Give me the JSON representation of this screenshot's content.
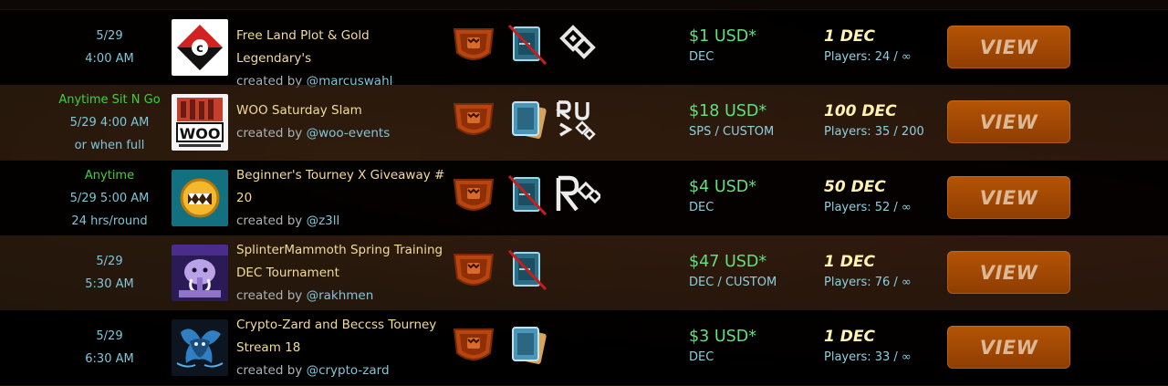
{
  "rows": [
    {
      "time": [
        "5/29",
        "4:00 AM"
      ],
      "time_highlight": "",
      "title": [
        "Free Land Plot & Gold Legendary's"
      ],
      "creator_prefix": "created by ",
      "creator": "@marcuswahl",
      "logo": "c-letter-logo",
      "format_icons": [
        "shield-icon",
        "card-crossed-icon",
        "diamond-rule-icon"
      ],
      "prize_amount": "$1 USD*",
      "prize_unit": "DEC",
      "entry_fee": "1 DEC",
      "players": "Players: 24 / ∞",
      "view_label": "VIEW"
    },
    {
      "time": [
        "5/29 4:00 AM",
        "or when full"
      ],
      "time_highlight": "Anytime Sit N Go",
      "title": [
        "WOO Saturday Slam"
      ],
      "creator_prefix": "created by ",
      "creator": "@woo-events",
      "logo": "woo-logo",
      "logo_text": "WOO",
      "format_icons": [
        "shield-icon",
        "cards-stack-icon",
        "ru-rules-icon"
      ],
      "prize_amount": "$18 USD*",
      "prize_unit": "SPS / CUSTOM",
      "entry_fee": "100 DEC",
      "players": "Players: 35 / 200",
      "view_label": "VIEW"
    },
    {
      "time": [
        "5/29 5:00 AM",
        "24 hrs/round"
      ],
      "time_highlight": "Anytime",
      "title": [
        "Beginner's Tourney X Giveaway #",
        "20"
      ],
      "creator_prefix": "created by ",
      "creator": "@z3ll",
      "logo": "monster-face-logo",
      "format_icons": [
        "shield-icon",
        "card-crossed-icon",
        "r-diamond-icon"
      ],
      "prize_amount": "$4 USD*",
      "prize_unit": "DEC",
      "entry_fee": "50 DEC",
      "players": "Players: 52 / ∞",
      "view_label": "VIEW"
    },
    {
      "time": [
        "5/29",
        "5:30 AM"
      ],
      "time_highlight": "",
      "title": [
        "SplinterMammoth Spring Training",
        "DEC Tournament"
      ],
      "creator_prefix": "created by ",
      "creator": "@rakhmen",
      "logo": "mammoth-logo",
      "format_icons": [
        "shield-icon",
        "card-crossed-icon"
      ],
      "prize_amount": "$47 USD*",
      "prize_unit": "DEC / CUSTOM",
      "entry_fee": "1 DEC",
      "players": "Players: 76 / ∞",
      "view_label": "VIEW"
    },
    {
      "time": [
        "5/29",
        "6:30 AM"
      ],
      "time_highlight": "",
      "title": [
        "Crypto-Zard and Beccss Tourney",
        "Stream 18"
      ],
      "creator_prefix": "created by ",
      "creator": "@crypto-zard",
      "logo": "dragon-logo",
      "format_icons": [
        "shield-icon",
        "cards-stack-icon"
      ],
      "prize_amount": "$3 USD*",
      "prize_unit": "DEC",
      "entry_fee": "1 DEC",
      "players": "Players: 33 / ∞",
      "view_label": "VIEW"
    }
  ],
  "colors": {
    "accent_orange": "#a84a04",
    "prize_green": "#62e07c",
    "title_gold": "#f1dc9a",
    "info_blue": "#7fc6d9",
    "highlight_green": "#3fd13c"
  }
}
